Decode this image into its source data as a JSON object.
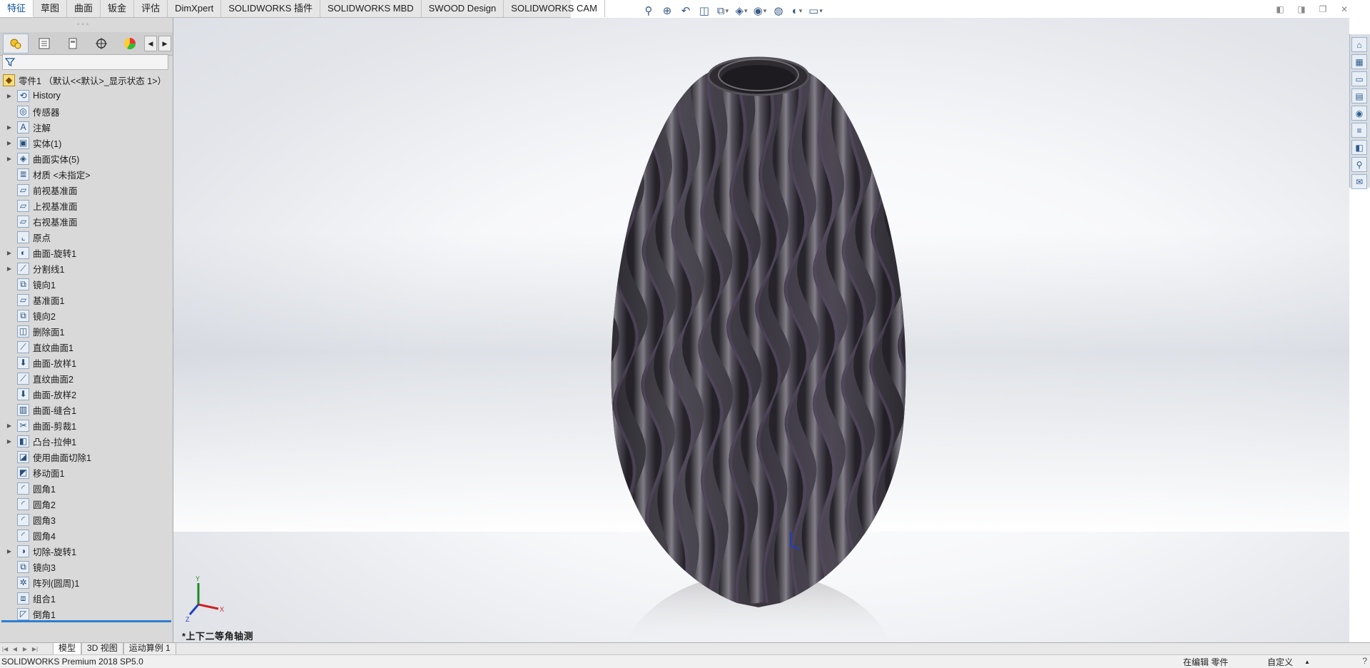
{
  "command_tabs": [
    "特征",
    "草图",
    "曲面",
    "钣金",
    "评估",
    "DimXpert",
    "SOLIDWORKS 插件",
    "SOLIDWORKS MBD",
    "SWOOD Design",
    "SOLIDWORKS CAM"
  ],
  "hud_icons": [
    "zoom-to-fit-icon",
    "zoom-area-icon",
    "previous-view-icon",
    "section-view-icon",
    "view-orientation-icon",
    "display-style-icon",
    "hide-show-icon",
    "edit-appearance-icon",
    "apply-scene-icon",
    "view-settings-icon"
  ],
  "feature_tree": {
    "root": "零件1 （默认<<默认>_显示状态 1>）",
    "items": [
      {
        "label": "History",
        "expandable": true,
        "icon": "history-icon",
        "glyph": "⟲"
      },
      {
        "label": "传感器",
        "expandable": false,
        "icon": "sensor-icon",
        "glyph": "◎"
      },
      {
        "label": "注解",
        "expandable": true,
        "icon": "annotation-icon",
        "glyph": "A"
      },
      {
        "label": "实体(1)",
        "expandable": true,
        "icon": "solid-bodies-icon",
        "glyph": "▣"
      },
      {
        "label": "曲面实体(5)",
        "expandable": true,
        "icon": "surface-bodies-icon",
        "glyph": "◈"
      },
      {
        "label": "材质 <未指定>",
        "expandable": false,
        "icon": "material-icon",
        "glyph": "≣"
      },
      {
        "label": "前视基准面",
        "expandable": false,
        "icon": "plane-icon",
        "glyph": "▱"
      },
      {
        "label": "上视基准面",
        "expandable": false,
        "icon": "plane-icon",
        "glyph": "▱"
      },
      {
        "label": "右视基准面",
        "expandable": false,
        "icon": "plane-icon",
        "glyph": "▱"
      },
      {
        "label": "原点",
        "expandable": false,
        "icon": "origin-icon",
        "glyph": "⌞"
      },
      {
        "label": "曲面-旋转1",
        "expandable": true,
        "icon": "revolve-surface-icon",
        "glyph": "◐"
      },
      {
        "label": "分割线1",
        "expandable": true,
        "icon": "split-line-icon",
        "glyph": "⟋"
      },
      {
        "label": "镜向1",
        "expandable": false,
        "icon": "mirror-icon",
        "glyph": "⧉"
      },
      {
        "label": "基准面1",
        "expandable": false,
        "icon": "plane-icon",
        "glyph": "▱"
      },
      {
        "label": "镜向2",
        "expandable": false,
        "icon": "mirror-icon",
        "glyph": "⧉"
      },
      {
        "label": "删除面1",
        "expandable": false,
        "icon": "delete-face-icon",
        "glyph": "◫"
      },
      {
        "label": "直纹曲面1",
        "expandable": false,
        "icon": "ruled-surface-icon",
        "glyph": "⟋"
      },
      {
        "label": "曲面-放样1",
        "expandable": false,
        "icon": "loft-surface-icon",
        "glyph": "⬇"
      },
      {
        "label": "直纹曲面2",
        "expandable": false,
        "icon": "ruled-surface-icon",
        "glyph": "⟋"
      },
      {
        "label": "曲面-放样2",
        "expandable": false,
        "icon": "loft-surface-icon",
        "glyph": "⬇"
      },
      {
        "label": "曲面-缝合1",
        "expandable": false,
        "icon": "knit-surface-icon",
        "glyph": "▥"
      },
      {
        "label": "曲面-剪裁1",
        "expandable": true,
        "icon": "trim-surface-icon",
        "glyph": "✂"
      },
      {
        "label": "凸台-拉伸1",
        "expandable": true,
        "icon": "extrude-boss-icon",
        "glyph": "◧"
      },
      {
        "label": "使用曲面切除1",
        "expandable": false,
        "icon": "surface-cut-icon",
        "glyph": "◪"
      },
      {
        "label": "移动面1",
        "expandable": false,
        "icon": "move-face-icon",
        "glyph": "◩"
      },
      {
        "label": "圆角1",
        "expandable": false,
        "icon": "fillet-icon",
        "glyph": "◜"
      },
      {
        "label": "圆角2",
        "expandable": false,
        "icon": "fillet-icon",
        "glyph": "◜"
      },
      {
        "label": "圆角3",
        "expandable": false,
        "icon": "fillet-icon",
        "glyph": "◜"
      },
      {
        "label": "圆角4",
        "expandable": false,
        "icon": "fillet-icon",
        "glyph": "◜"
      },
      {
        "label": "切除-旋转1",
        "expandable": true,
        "icon": "revolve-cut-icon",
        "glyph": "◑"
      },
      {
        "label": "镜向3",
        "expandable": false,
        "icon": "mirror-icon",
        "glyph": "⧉"
      },
      {
        "label": "阵列(圆周)1",
        "expandable": false,
        "icon": "circular-pattern-icon",
        "glyph": "✲"
      },
      {
        "label": "组合1",
        "expandable": false,
        "icon": "combine-icon",
        "glyph": "⧈"
      },
      {
        "label": "倒角1",
        "expandable": false,
        "icon": "chamfer-icon",
        "glyph": "◸"
      }
    ]
  },
  "viewport": {
    "view_name": "*上下二等角轴测",
    "triad_axes": [
      "X",
      "Y",
      "Z"
    ]
  },
  "bottom_tabs": [
    "模型",
    "3D 视图",
    "运动算例 1"
  ],
  "status": {
    "product": "SOLIDWORKS Premium 2018 SP5.0",
    "mode": "在编辑 零件",
    "units": "自定义"
  },
  "colors": {
    "accent": "#2d7fd1",
    "model_dark": "#3a373d",
    "model_highlight": "#8a8790",
    "model_purple": "#4a3a55"
  }
}
